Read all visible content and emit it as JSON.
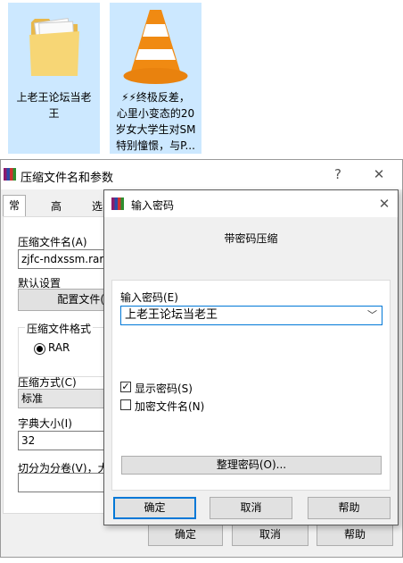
{
  "desktop": {
    "files": [
      {
        "label": "上老王论坛当老\n王",
        "icon": "folder-icon"
      },
      {
        "label": "⚡⚡终极反差，\n心里小变态的20\n岁女大学生对SM\n特别憧憬，与P...",
        "icon": "vlc-cone-icon"
      }
    ]
  },
  "back_dialog": {
    "title": "压缩文件名和参数",
    "help_glyph": "?",
    "close_glyph": "✕",
    "tabs": [
      "常规",
      "高级",
      "选"
    ],
    "archive_name_label": "压缩文件名(A)",
    "archive_name_value": "zjfc-ndxssm.rar",
    "default_settings_label": "默认设置",
    "profile_button": "配置文件(",
    "format_group_label": "压缩文件格式",
    "format_rar": "RAR",
    "method_label": "压缩方式(C)",
    "method_value": "标准",
    "dict_label": "字典大小(I)",
    "dict_value": "32",
    "split_label": "切分为分卷(V)，大",
    "ok_button": "确定",
    "cancel_button": "取消",
    "help_button": "帮助"
  },
  "password_dialog": {
    "title": "输入密码",
    "close_glyph": "✕",
    "heading": "带密码压缩",
    "password_label": "输入密码(E)",
    "password_value": "上老王论坛当老王",
    "show_password_label": "显示密码(S)",
    "show_password_checked": true,
    "encrypt_names_label": "加密文件名(N)",
    "encrypt_names_checked": false,
    "organize_button": "整理密码(O)...",
    "ok_button": "确定",
    "cancel_button": "取消",
    "help_button": "帮助"
  },
  "colors": {
    "selection": "#cce8ff",
    "accent": "#0078d7"
  }
}
